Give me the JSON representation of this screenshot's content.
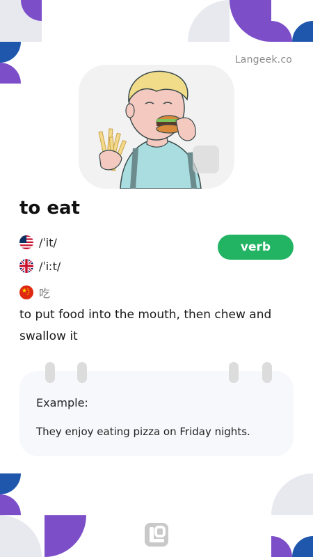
{
  "brand": {
    "site": "Langeek.co"
  },
  "illustration": {
    "name": "man-eating-burger-and-fries"
  },
  "entry": {
    "word": "to eat",
    "part_of_speech": "verb",
    "pronunciations": [
      {
        "region": "US",
        "flag": "us-flag-icon",
        "ipa": "/ˈit/"
      },
      {
        "region": "UK",
        "flag": "uk-flag-icon",
        "ipa": "/ˈiːt/"
      }
    ],
    "translation": {
      "region": "CN",
      "flag": "china-flag-icon",
      "text": "吃"
    },
    "definition": "to put food into the mouth, then chew and swallow it",
    "example": {
      "label": "Example:",
      "sentence": "They enjoy eating pizza on Friday nights."
    }
  },
  "colors": {
    "accent_green": "#22b463",
    "purple": "#7c4fc9",
    "blue": "#1f57ad",
    "light_gray": "#e8e9ef"
  }
}
